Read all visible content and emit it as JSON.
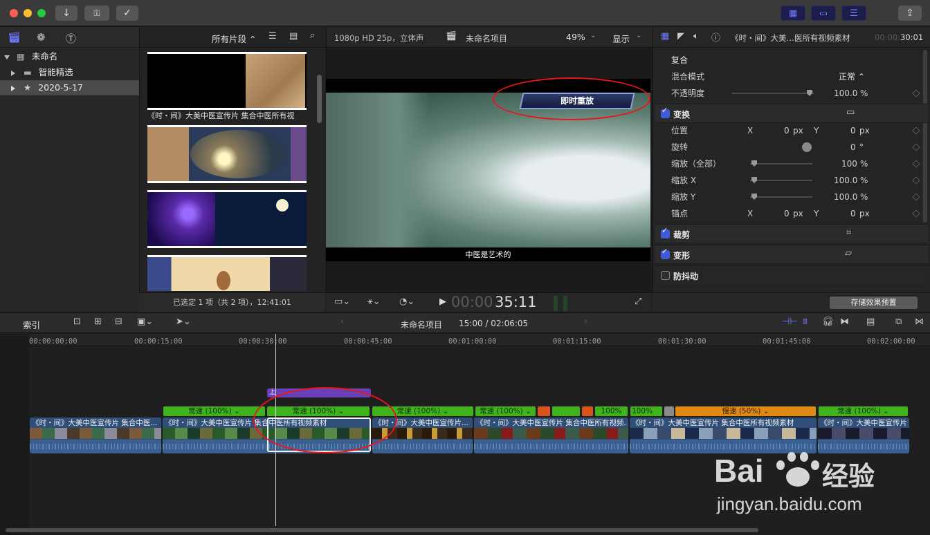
{
  "toolbar": {
    "import_icon": "download-arrow-icon",
    "keyword_icon": "key-icon",
    "analyze_icon": "checkmark-circle-icon",
    "share_icon": "share-icon"
  },
  "library": {
    "root_name": "未命名",
    "items": [
      {
        "label": "智能精选"
      },
      {
        "label": "2020-5-17"
      }
    ]
  },
  "browser": {
    "filter_label": "所有片段 ⌃",
    "clip1_caption": "《时・间》大美中医宣传片 集合中医所有视",
    "status": "已选定 1 项（共 2 项），12:41:01"
  },
  "viewer": {
    "format": "1080p HD 25p，立体声",
    "project": "未命名项目",
    "zoom": "49%",
    "display": "显示",
    "overlay_title": "即时重放",
    "subtitle": "中医是艺术的",
    "timecode_dim": "00:00",
    "timecode": "35:11"
  },
  "inspector": {
    "clip_name": "《时・间》大美…医所有视频素材",
    "duration_dim": "00:00:",
    "duration": "30:01",
    "compositing": "复合",
    "blend_mode_label": "混合模式",
    "blend_mode_value": "正常 ⌃",
    "opacity_label": "不透明度",
    "opacity_value": "100.0",
    "transform": "变换",
    "position_label": "位置",
    "pos_x": "0",
    "pos_y": "0",
    "rotation_label": "旋转",
    "rotation_value": "0",
    "scale_all_label": "缩放（全部）",
    "scale_all_value": "100",
    "scale_x_label": "缩放 X",
    "scale_x_value": "100.0",
    "scale_y_label": "缩放 Y",
    "scale_y_value": "100.0",
    "anchor_label": "锚点",
    "anchor_x": "0",
    "anchor_y": "0",
    "crop": "裁剪",
    "distort": "变形",
    "stabilization": "防抖动",
    "save_preset": "存储效果预置",
    "units": {
      "px": "px",
      "pct": "%",
      "deg": "°",
      "x": "X",
      "y": "Y"
    }
  },
  "timeline": {
    "index": "索引",
    "project": "未命名项目",
    "position": "15:00 / 02:06:05",
    "ruler": [
      "00:00:00:00",
      "00:00:15:00",
      "00:00:30:00",
      "00:00:45:00",
      "00:01:00:00",
      "00:01:15:00",
      "00:01:30:00",
      "00:01:45:00",
      "00:02:00:00"
    ],
    "title_clip": "上",
    "speeds": [
      "常速 (100%) ⌄",
      "常速 (100%) ⌄",
      "常速 (100%) ⌄",
      "常速 (100%) ⌄",
      "100%",
      "100%",
      "慢速 (50%) ⌄",
      "常速 (100%) ⌄"
    ],
    "clips": [
      "《时・间》大美中医宣传片 集合中医...",
      "《时・间》大美中医宣传片 集合中医所有视频素材",
      "《时・间》大美中医宣传片...",
      "《时・间》大美中医宣传片 集合中医所有视频...",
      "《时・间》大美中医宣传片 集合中医所有视频素材",
      "《时・间》大美中医宣传片..."
    ]
  },
  "watermark": {
    "brand": "Bai",
    "brand2": "经验",
    "url": "jingyan.baidu.com"
  }
}
